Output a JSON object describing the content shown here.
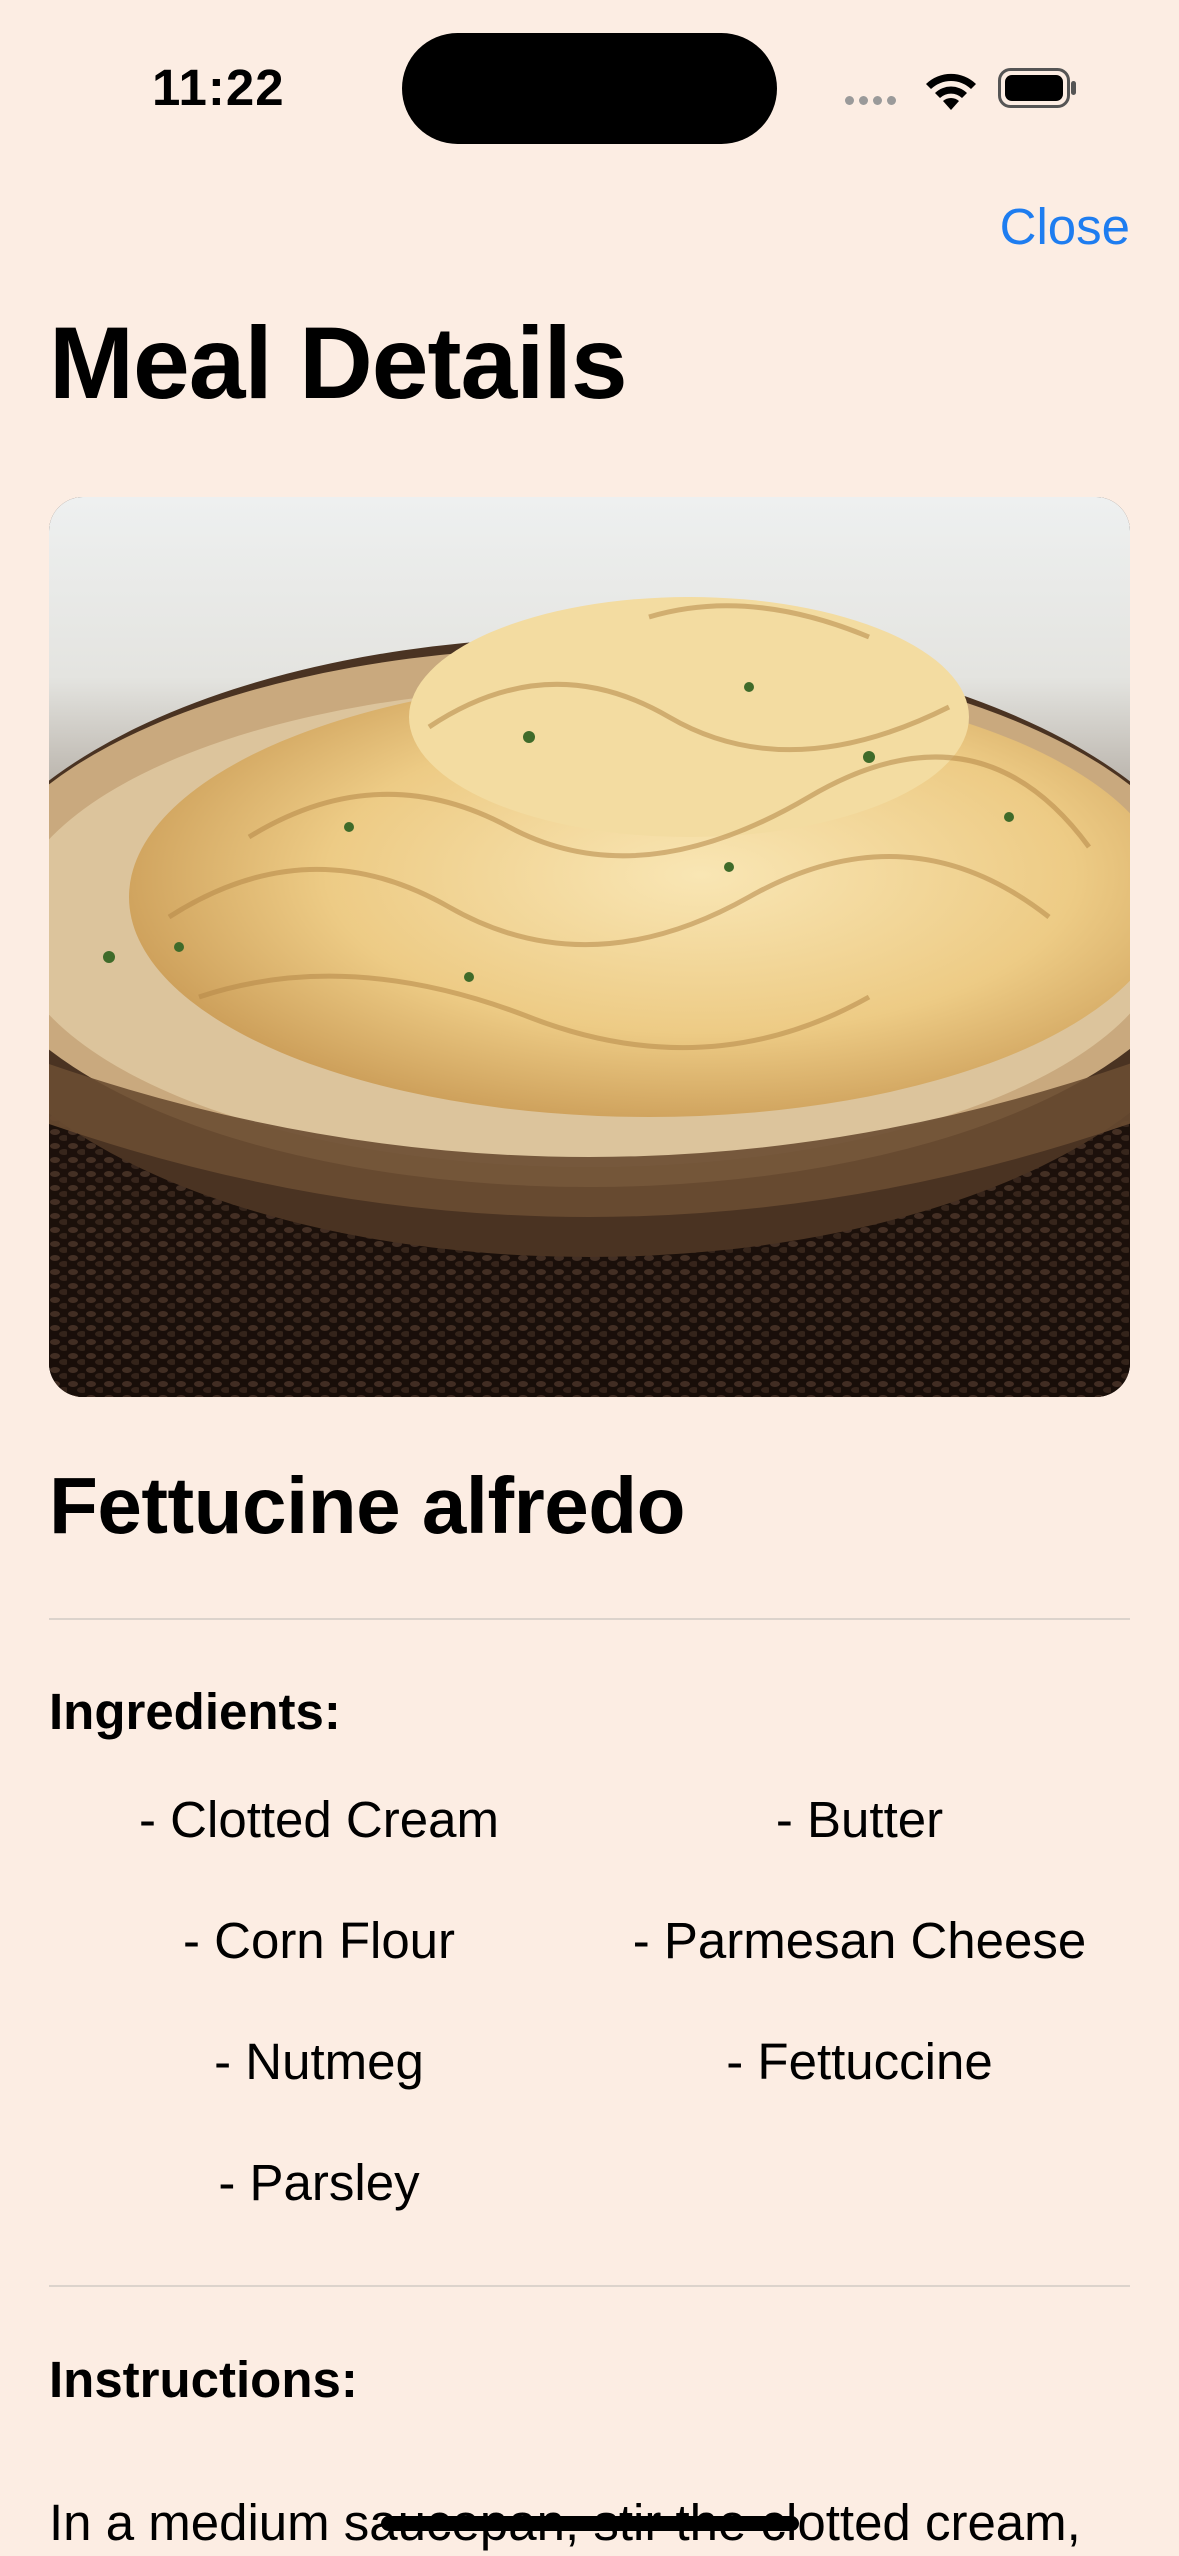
{
  "status_bar": {
    "time": "11:22"
  },
  "nav": {
    "close_label": "Close"
  },
  "page": {
    "title": "Meal Details"
  },
  "meal": {
    "name": "Fettucine alfredo",
    "image_subject": "bowl of fettuccine alfredo"
  },
  "ingredients": {
    "heading": "Ingredients:",
    "items": [
      "- Clotted Cream",
      "- Butter",
      "- Corn Flour",
      "- Parmesan Cheese",
      "- Nutmeg",
      "- Fettuccine",
      "- Parsley"
    ]
  },
  "instructions": {
    "heading": "Instructions:",
    "text": "In a medium saucepan, stir the clotted cream,"
  },
  "colors": {
    "background": "#FCEDE3",
    "accent": "#1E7DF0",
    "divider": "#DCD3CC"
  },
  "icons": {
    "signal": "cellular-signal-icon",
    "wifi": "wifi-icon",
    "battery": "battery-icon"
  }
}
